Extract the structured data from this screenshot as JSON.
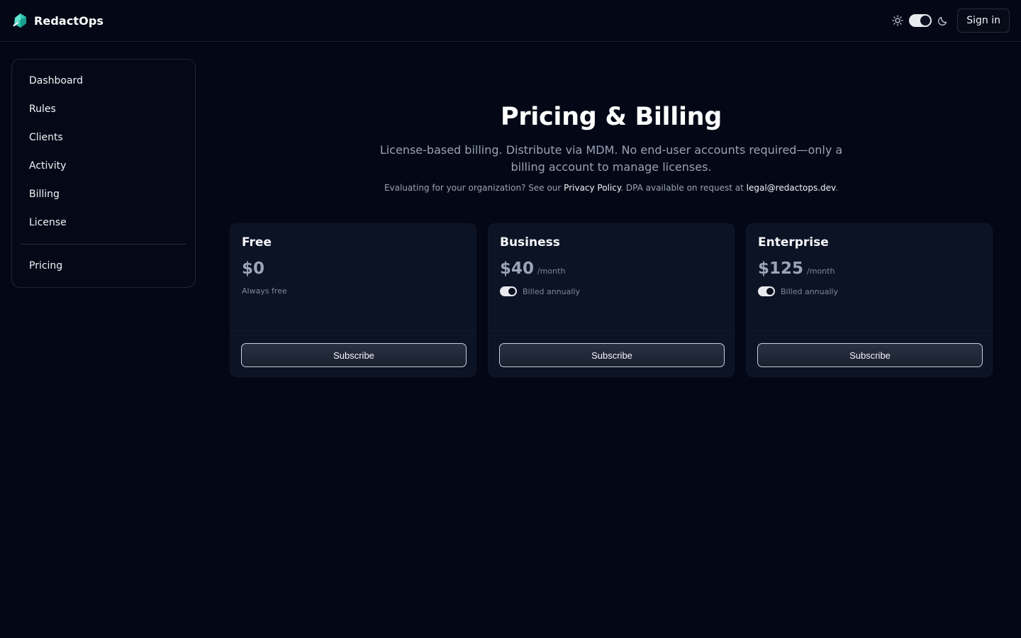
{
  "header": {
    "brand_name": "RedactOps",
    "logo_icon": "redactops-logo-icon",
    "signin_label": "Sign in",
    "theme_toggle": {
      "light_icon": "sun-icon",
      "dark_icon": "moon-icon",
      "state": "dark"
    }
  },
  "sidebar": {
    "items": [
      {
        "label": "Dashboard"
      },
      {
        "label": "Rules"
      },
      {
        "label": "Clients"
      },
      {
        "label": "Activity"
      },
      {
        "label": "Billing"
      },
      {
        "label": "License"
      }
    ],
    "footer_items": [
      {
        "label": "Pricing"
      }
    ]
  },
  "main": {
    "title": "Pricing & Billing",
    "subtitle": "License-based billing. Distribute via MDM. No end-user accounts required—only a billing account to manage licenses.",
    "note": {
      "prefix": "Evaluating for your organization? See our ",
      "privacy_link": "Privacy Policy",
      "middle": ". DPA available on request at ",
      "email_link": "legal@redactops.dev",
      "suffix": "."
    }
  },
  "plans": [
    {
      "name": "Free",
      "price": "$0",
      "period": "",
      "billing_note": "Always free",
      "toggle": false,
      "button": "Subscribe"
    },
    {
      "name": "Business",
      "price": "$40",
      "period": "/month",
      "billing_note": "Billed annually",
      "toggle": true,
      "button": "Subscribe"
    },
    {
      "name": "Enterprise",
      "price": "$125",
      "period": "/month",
      "billing_note": "Billed annually",
      "toggle": true,
      "button": "Subscribe"
    }
  ],
  "colors": {
    "background": "#040816",
    "card": "#0c1324",
    "logo_accent": "#2dd4bf",
    "muted_text": "#98a2b6"
  }
}
